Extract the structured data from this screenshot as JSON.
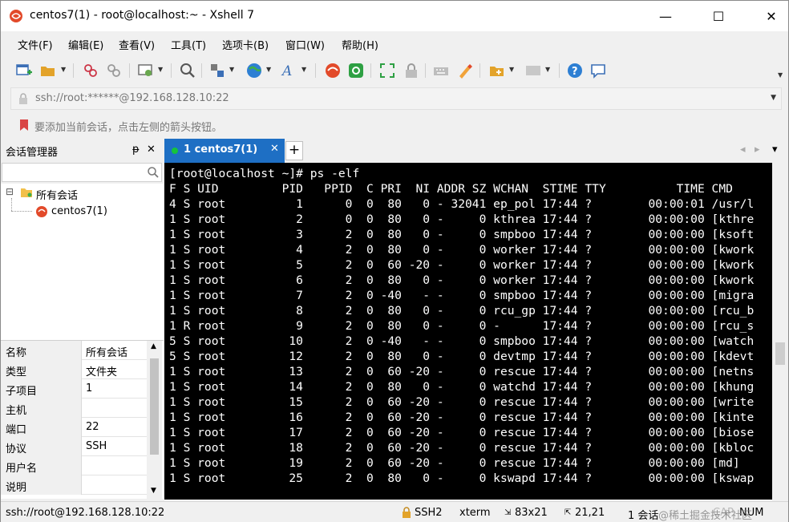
{
  "window": {
    "title": "centos7(1) - root@localhost:~ - Xshell 7",
    "minimize_glyph": "—",
    "maximize_glyph": "☐",
    "close_glyph": "✕"
  },
  "menu": [
    "文件(F)",
    "编辑(E)",
    "查看(V)",
    "工具(T)",
    "选项卡(B)",
    "窗口(W)",
    "帮助(H)"
  ],
  "address": {
    "value": "ssh://root:******@192.168.128.10:22",
    "dropdown_glyph": "▼"
  },
  "hint": "要添加当前会话，点击左侧的箭头按钮。",
  "session_manager": {
    "title": "会话管理器",
    "pin_glyph": "ᵽ",
    "close_glyph": "✕",
    "search_placeholder": "",
    "tree": {
      "expander": "⊟",
      "root_label": "所有会话",
      "child_label": "centos7(1)"
    },
    "properties": [
      {
        "key": "名称",
        "value": "所有会话"
      },
      {
        "key": "类型",
        "value": "文件夹"
      },
      {
        "key": "子项目",
        "value": "1"
      },
      {
        "key": "主机",
        "value": ""
      },
      {
        "key": "端口",
        "value": "22"
      },
      {
        "key": "协议",
        "value": "SSH"
      },
      {
        "key": "用户名",
        "value": ""
      },
      {
        "key": "说明",
        "value": ""
      }
    ]
  },
  "tabs": {
    "active_label": "1 centos7(1)",
    "close_glyph": "✕",
    "add_glyph": "+",
    "nav_left": "◂",
    "nav_right": "▸",
    "nav_down": "▾"
  },
  "terminal": {
    "lines": [
      "[root@localhost ~]# ps -elf",
      "F S UID         PID   PPID  C PRI  NI ADDR SZ WCHAN  STIME TTY          TIME CMD",
      "4 S root          1      0  0  80   0 - 32041 ep_pol 17:44 ?        00:00:01 /usr/l",
      "1 S root          2      0  0  80   0 -     0 kthrea 17:44 ?        00:00:00 [kthre",
      "1 S root          3      2  0  80   0 -     0 smpboo 17:44 ?        00:00:00 [ksoft",
      "1 S root          4      2  0  80   0 -     0 worker 17:44 ?        00:00:00 [kwork",
      "1 S root          5      2  0  60 -20 -     0 worker 17:44 ?        00:00:00 [kwork",
      "1 S root          6      2  0  80   0 -     0 worker 17:44 ?        00:00:00 [kwork",
      "1 S root          7      2  0 -40   - -     0 smpboo 17:44 ?        00:00:00 [migra",
      "1 S root          8      2  0  80   0 -     0 rcu_gp 17:44 ?        00:00:00 [rcu_b",
      "1 R root          9      2  0  80   0 -     0 -      17:44 ?        00:00:00 [rcu_s",
      "5 S root         10      2  0 -40   - -     0 smpboo 17:44 ?        00:00:00 [watch",
      "5 S root         12      2  0  80   0 -     0 devtmp 17:44 ?        00:00:00 [kdevt",
      "1 S root         13      2  0  60 -20 -     0 rescue 17:44 ?        00:00:00 [netns",
      "1 S root         14      2  0  80   0 -     0 watchd 17:44 ?        00:00:00 [khung",
      "1 S root         15      2  0  60 -20 -     0 rescue 17:44 ?        00:00:00 [write",
      "1 S root         16      2  0  60 -20 -     0 rescue 17:44 ?        00:00:00 [kinte",
      "1 S root         17      2  0  60 -20 -     0 rescue 17:44 ?        00:00:00 [biose",
      "1 S root         18      2  0  60 -20 -     0 rescue 17:44 ?        00:00:00 [kbloc",
      "1 S root         19      2  0  60 -20 -     0 rescue 17:44 ?        00:00:00 [md]",
      "1 S root         25      2  0  80   0 -     0 kswapd 17:44 ?        00:00:00 [kswap"
    ]
  },
  "status": {
    "connection": "ssh://root@192.168.128.10:22",
    "protocol": "SSH2",
    "term_type": "xterm",
    "size": "83x21",
    "cursor": "21,21",
    "sessions": "1 会话",
    "caps": "CAP",
    "num": "NUM",
    "watermark": "@稀土掘金技术社区"
  },
  "colors": {
    "tab_active": "#1e6fc4",
    "terminal_bg": "#000000",
    "terminal_fg": "#ffffff",
    "status_dot": "#16c43c"
  }
}
